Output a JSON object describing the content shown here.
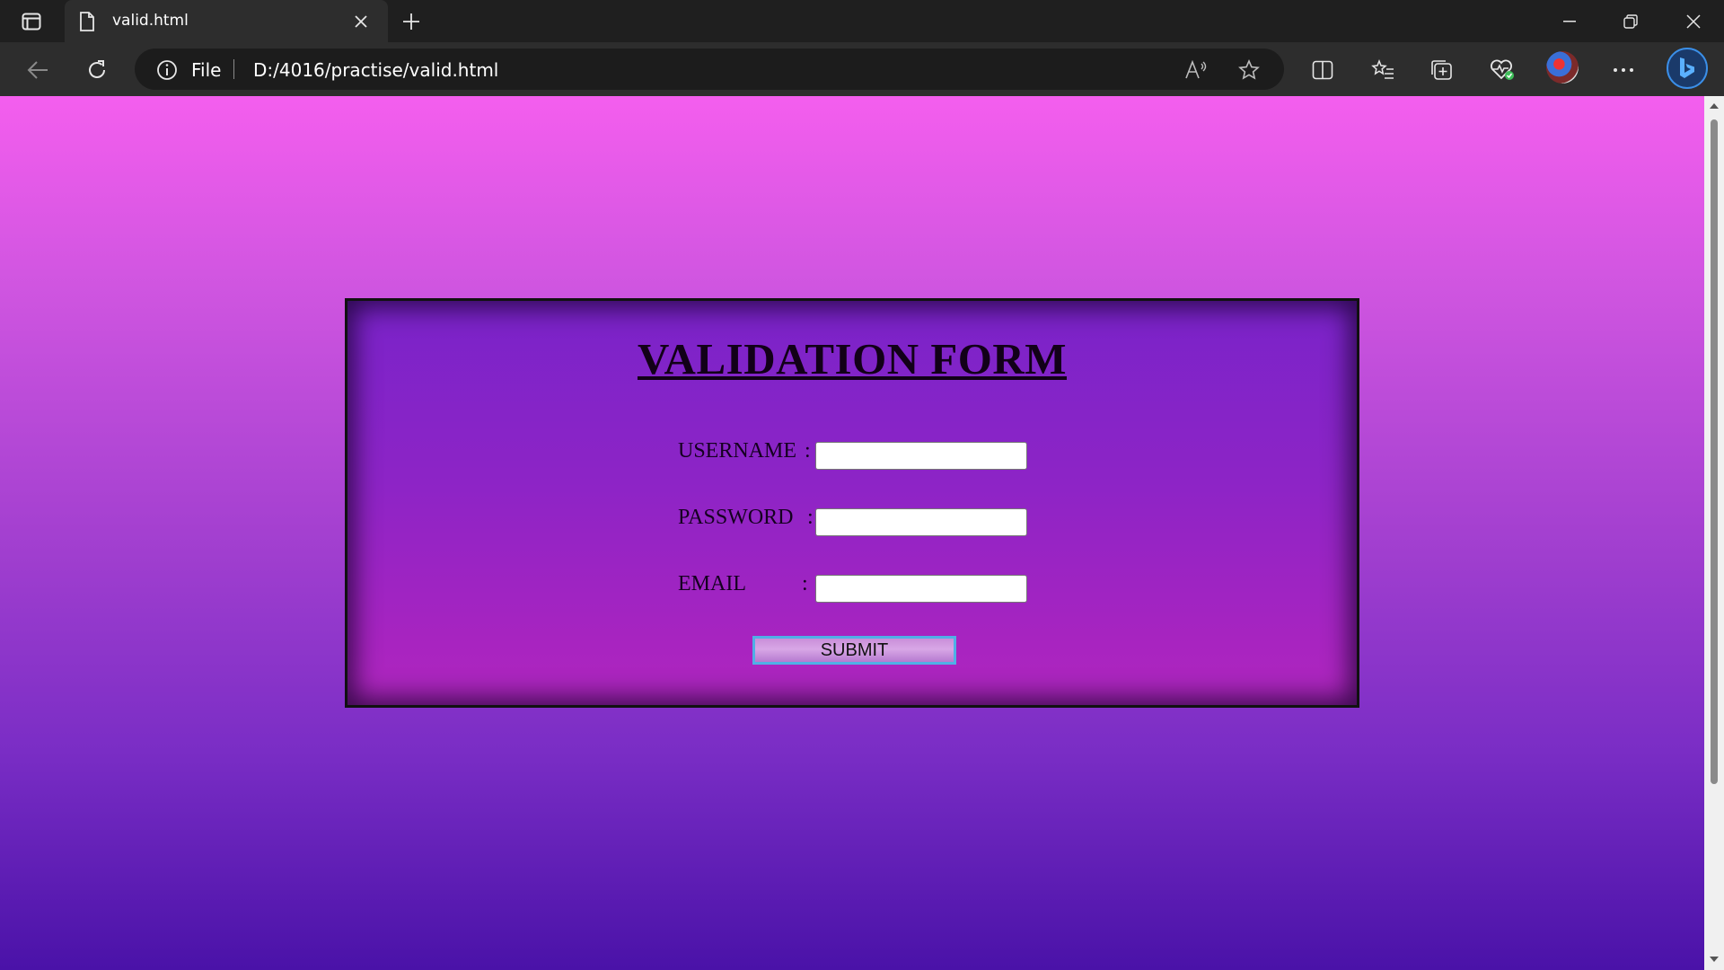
{
  "browser": {
    "tab": {
      "title": "valid.html"
    },
    "address": {
      "scheme_label": "File",
      "url": "D:/4016/practise/valid.html"
    }
  },
  "page": {
    "form": {
      "title": "VALIDATION FORM",
      "fields": [
        {
          "label": "USERNAME",
          "colon": ":",
          "value": ""
        },
        {
          "label": "PASSWORD",
          "colon": ":",
          "value": ""
        },
        {
          "label": "EMAIL",
          "colon": ":",
          "value": ""
        }
      ],
      "submit_label": "SUBMIT"
    }
  },
  "colors": {
    "page_gradient_top": "#f45eee",
    "page_gradient_bottom": "#4a12a8",
    "card_top": "#7a23c9",
    "card_bottom": "#b027be",
    "submit_border": "#4fb0e6"
  }
}
